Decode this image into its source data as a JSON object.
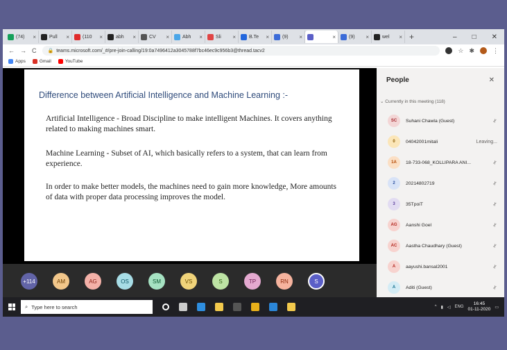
{
  "browser": {
    "tabs": [
      {
        "label": "(74)",
        "color": "#16a05a",
        "active": false
      },
      {
        "label": "Pull",
        "color": "#222222",
        "active": false
      },
      {
        "label": "(110",
        "color": "#e02b2b",
        "active": false
      },
      {
        "label": "abh",
        "color": "#222222",
        "active": false
      },
      {
        "label": "CV",
        "color": "#555555",
        "active": false
      },
      {
        "label": "Abh",
        "color": "#4aa6e8",
        "active": false
      },
      {
        "label": "Sli",
        "color": "#e04545",
        "active": false
      },
      {
        "label": "B.Te",
        "color": "#2266dd",
        "active": false
      },
      {
        "label": "(9)",
        "color": "#3b6bd8",
        "active": false
      },
      {
        "label": "",
        "color": "#5b5fc7",
        "active": true
      },
      {
        "label": "(9)",
        "color": "#3b6bd8",
        "active": false
      },
      {
        "label": "wel",
        "color": "#222222",
        "active": false
      }
    ],
    "new_tab": "+",
    "window_controls": [
      "–",
      "□",
      "✕"
    ],
    "url": "teams.microsoft.com/_#/pre-join-calling/19:0a7496412a3045788f7bc46ec9c956b3@thread.tacv2",
    "bookmarks": [
      {
        "label": "Apps",
        "color": "#4285f4"
      },
      {
        "label": "Gmail",
        "color": "#d93025"
      },
      {
        "label": "YouTube",
        "color": "#ff0000"
      }
    ]
  },
  "slide": {
    "title": "Difference between Artificial Intelligence and Machine Learning :-",
    "paragraphs": [
      "Artificial Intelligence - Broad Discipline to make intelligent Machines. It covers anything related to making machines smart.",
      "Machine Learning - Subset of AI, which basically refers to a system, that can learn from experience.",
      "In order to make better models, the machines need to gain more knowledge, More amounts of data with proper data processing improves the model."
    ]
  },
  "people": {
    "title": "People",
    "close": "✕",
    "section_label": "Currently in this meeting (118)",
    "participants": [
      {
        "initials": "SC",
        "name": "Suhani Chawla (Guest)",
        "status": "",
        "bg": "#f3d6d6",
        "fg": "#a4262c"
      },
      {
        "initials": "0",
        "name": "04042001mitali",
        "status": "Leaving...",
        "bg": "#fbe6b8",
        "fg": "#8a5a00"
      },
      {
        "initials": "1A",
        "name": "18-733-068_KOLLIPARA ANI...",
        "status": "",
        "bg": "#fbdfc4",
        "fg": "#b34700"
      },
      {
        "initials": "2",
        "name": "20214802719",
        "status": "",
        "bg": "#d8e3f7",
        "fg": "#2b4f9e"
      },
      {
        "initials": "3",
        "name": "35TpoiT",
        "status": "",
        "bg": "#e2dcf2",
        "fg": "#5c3f9e"
      },
      {
        "initials": "AG",
        "name": "Aanshi Goel",
        "status": "",
        "bg": "#f7d3cf",
        "fg": "#b3261e"
      },
      {
        "initials": "AC",
        "name": "Aastha Chaudhary (Guest)",
        "status": "",
        "bg": "#f7d3cf",
        "fg": "#b3261e"
      },
      {
        "initials": "A",
        "name": "aayushi.bansal2001",
        "status": "",
        "bg": "#f7d3cf",
        "fg": "#b3261e"
      },
      {
        "initials": "A",
        "name": "Aditi (Guest)",
        "status": "",
        "bg": "#d4ecf5",
        "fg": "#0f6c8c"
      }
    ]
  },
  "tray": {
    "avatars": [
      {
        "label": "+114",
        "bg": "#6264a7",
        "fg": "#ffffff"
      },
      {
        "label": "AM",
        "bg": "#f2c78b",
        "fg": "#6b3e00"
      },
      {
        "label": "AG",
        "bg": "#f4b1a8",
        "fg": "#8a1f14"
      },
      {
        "label": "OS",
        "bg": "#a7dde6",
        "fg": "#0b5565"
      },
      {
        "label": "SM",
        "bg": "#a6e2c2",
        "fg": "#0d5a32"
      },
      {
        "label": "VS",
        "bg": "#f0d37a",
        "fg": "#6b4e00"
      },
      {
        "label": "S",
        "bg": "#bde3a4",
        "fg": "#2f5e12"
      },
      {
        "label": "TP",
        "bg": "#e4a9d0",
        "fg": "#6e1c52"
      },
      {
        "label": "RN",
        "bg": "#f6b39e",
        "fg": "#8c2a0c"
      },
      {
        "label": "S",
        "bg": "#5b5fc7",
        "fg": "#ffffff"
      }
    ]
  },
  "taskbar": {
    "search_placeholder": "Type here to search",
    "tray_lang": "ENG",
    "clock_time": "16:45",
    "clock_date": "01-11-2020",
    "pinned": [
      {
        "name": "cortana",
        "color": "#ffffff"
      },
      {
        "name": "task-view",
        "color": "#cccccc"
      },
      {
        "name": "edge",
        "color": "#2e8ee0"
      },
      {
        "name": "file-explorer",
        "color": "#f2c94c"
      },
      {
        "name": "terminal",
        "color": "#555555"
      },
      {
        "name": "chrome",
        "color": "#e8b01a"
      },
      {
        "name": "vscode",
        "color": "#2b86d8"
      },
      {
        "name": "store",
        "color": "#f2c94c"
      }
    ]
  }
}
